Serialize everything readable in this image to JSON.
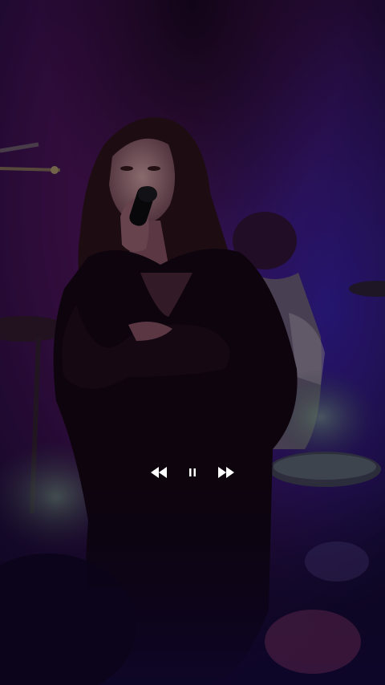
{
  "player": {
    "state": "paused-controls-visible",
    "controls": {
      "rewind_icon": "rewind-icon",
      "pause_icon": "pause-icon",
      "forward_icon": "fast-forward-icon",
      "icon_color": "#ffffff"
    },
    "scene": {
      "background_color": "#3a0f45",
      "accent_color": "#2a1a8a"
    }
  }
}
